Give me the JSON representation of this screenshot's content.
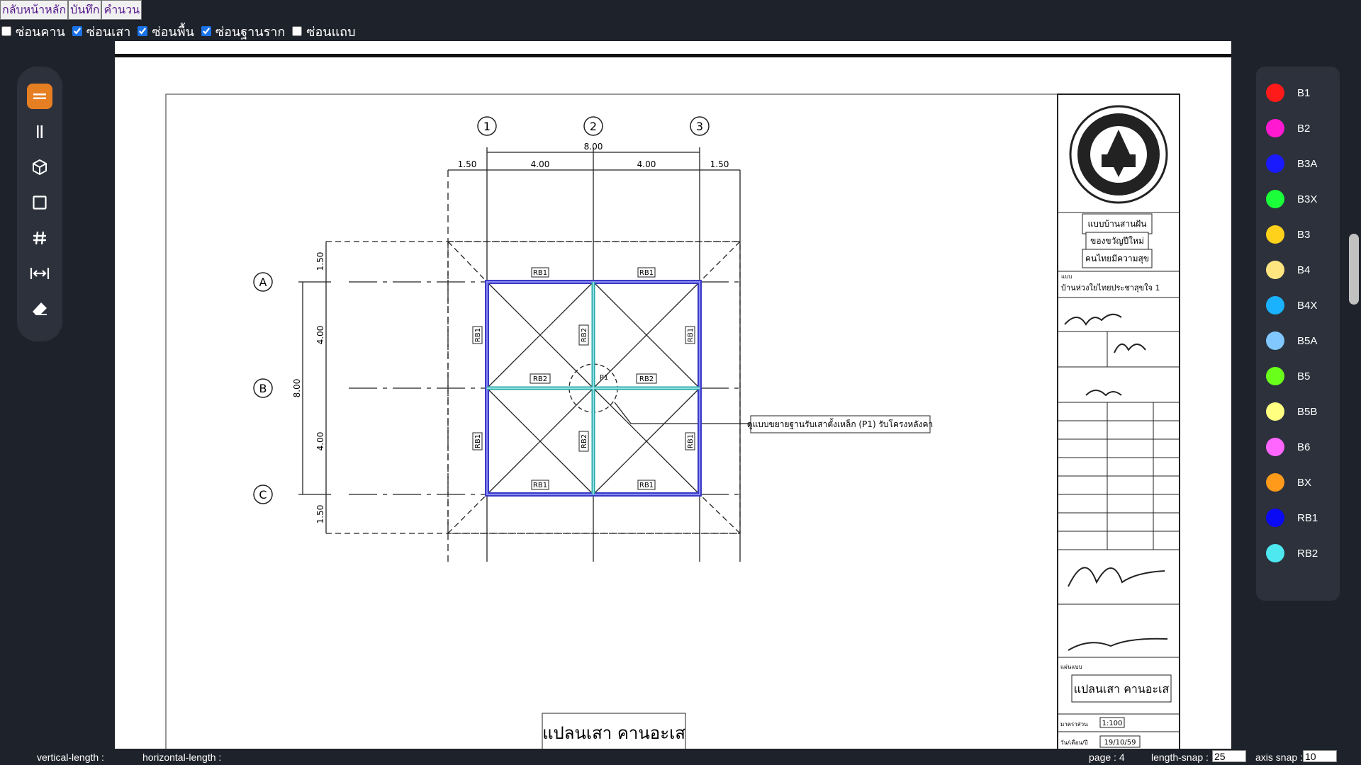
{
  "top_buttons": {
    "home": "กลับหน้าหลัก",
    "save": "บันทึก",
    "calculate": "คำนวน"
  },
  "filters": [
    {
      "label": "ซ่อนคาน",
      "checked": false
    },
    {
      "label": "ซ่อนเสา",
      "checked": true
    },
    {
      "label": "ซ่อนพื้น",
      "checked": true
    },
    {
      "label": "ซ่อนฐานราก",
      "checked": true
    },
    {
      "label": "ซ่อนแถบ",
      "checked": false
    }
  ],
  "toolbar": {
    "tools": [
      {
        "name": "beam-tool-icon",
        "active": true
      },
      {
        "name": "column-tool-icon",
        "active": false
      },
      {
        "name": "cube-tool-icon",
        "active": false
      },
      {
        "name": "slab-tool-icon",
        "active": false
      },
      {
        "name": "grid-tool-icon",
        "active": false
      },
      {
        "name": "dimension-tool-icon",
        "active": false
      },
      {
        "name": "eraser-tool-icon",
        "active": false
      }
    ],
    "accent": "#e67e22"
  },
  "legend": [
    {
      "label": "B1",
      "color": "#ff1a1a"
    },
    {
      "label": "B2",
      "color": "#ff1ad1"
    },
    {
      "label": "B3A",
      "color": "#1a1aff"
    },
    {
      "label": "B3X",
      "color": "#1aff3a"
    },
    {
      "label": "B3",
      "color": "#ffd11a"
    },
    {
      "label": "B4",
      "color": "#ffe580"
    },
    {
      "label": "B4X",
      "color": "#1ab2ff"
    },
    {
      "label": "B5A",
      "color": "#80c8ff"
    },
    {
      "label": "B5",
      "color": "#6aff1a"
    },
    {
      "label": "B5B",
      "color": "#ffff80"
    },
    {
      "label": "B6",
      "color": "#ff66ff"
    },
    {
      "label": "BX",
      "color": "#ff9a1a"
    },
    {
      "label": "RB1",
      "color": "#0a0af5"
    },
    {
      "label": "RB2",
      "color": "#4de8f0"
    }
  ],
  "drawing": {
    "grid_cols": [
      "1",
      "2",
      "3"
    ],
    "grid_rows": [
      "A",
      "B",
      "C"
    ],
    "dim_total_x": "8.00",
    "dims_x": [
      "1.50",
      "4.00",
      "4.00",
      "1.50"
    ],
    "dim_total_y": "8.00",
    "dims_y": [
      "1.50",
      "4.00",
      "4.00",
      "1.50"
    ],
    "beam_labels": {
      "rb1": "RB1",
      "rb2": "RB2",
      "p1": "P1"
    },
    "callout": "ดูแบบขยายฐานรับเสาตั้งเหล็ก (P1) รับโครงหลังคา",
    "plan_title": "แปลนเสา คานอะเส",
    "title_block": {
      "project_lines": [
        "แบบบ้านสานฝัน",
        "ของขวัญปีใหม่",
        "คนไทยมีความสุข"
      ],
      "type_label": "แบบ",
      "house_name": "บ้านห่วงใยไทยประชาสุขใจ 1",
      "sheet_label": "แผ่นแบบ",
      "sheet_title": "แปลนเสา คานอะเส",
      "scale_label": "มาตราส่วน",
      "scale": "1:100",
      "date_label": "วัน/เดือน/ปี",
      "date": "19/10/59"
    }
  },
  "status": {
    "vertical_length_label": "vertical-length :",
    "horizontal_length_label": "horizontal-length :",
    "page": "page : 4",
    "length_snap_label": "length-snap :",
    "length_snap_value": "25",
    "axis_snap_label": "axis snap :",
    "axis_snap_value": "10"
  }
}
